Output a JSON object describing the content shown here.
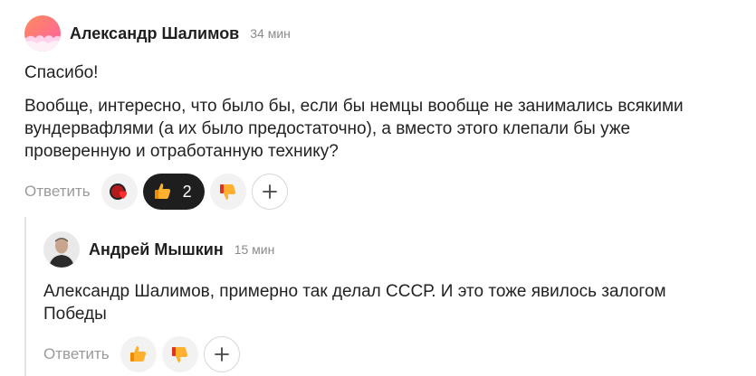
{
  "comment": {
    "author": "Александр Шалимов",
    "time": "34 мин",
    "paragraphs": [
      "Спасибо!",
      "Вообще, интересно, что было бы, если бы немцы вообще не занимались всякими вундервафлями (а их было предостаточно), а вместо этого клепали бы уже проверенную и отработанную технику?"
    ],
    "reply_label": "Ответить",
    "reactions": [
      {
        "icon": "heart-reaction-icon"
      },
      {
        "icon": "thumbs-up-icon",
        "count": "2"
      },
      {
        "icon": "thumbs-down-icon"
      },
      {
        "icon": "plus-icon"
      }
    ]
  },
  "reply": {
    "author": "Андрей Мышкин",
    "time": "15 мин",
    "text": "Александр Шалимов, примерно так делал СССР. И это тоже явилось залогом Победы",
    "reply_label": "Ответить",
    "reactions": [
      {
        "icon": "thumbs-up-icon"
      },
      {
        "icon": "thumbs-down-icon"
      },
      {
        "icon": "plus-icon"
      }
    ]
  }
}
